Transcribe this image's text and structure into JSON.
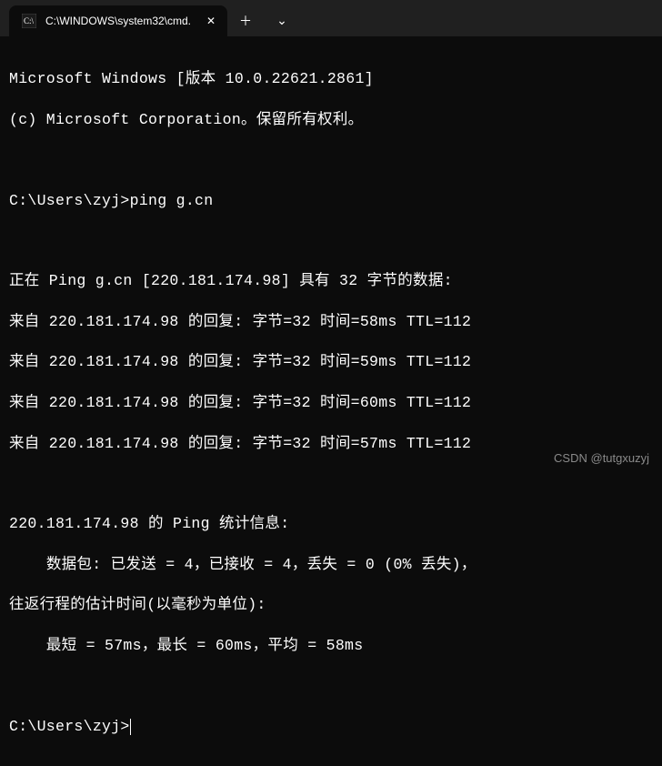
{
  "titlebar": {
    "tab_title": "C:\\WINDOWS\\system32\\cmd.",
    "close_glyph": "✕",
    "new_tab_glyph": "＋",
    "dropdown_glyph": "⌄"
  },
  "terminal": {
    "line_version": "Microsoft Windows [版本 10.0.22621.2861]",
    "line_copyright": "(c) Microsoft Corporation。保留所有权利。",
    "line_prompt1": "C:\\Users\\zyj>ping g.cn",
    "line_ping_header": "正在 Ping g.cn [220.181.174.98] 具有 32 字节的数据:",
    "line_reply1": "来自 220.181.174.98 的回复: 字节=32 时间=58ms TTL=112",
    "line_reply2": "来自 220.181.174.98 的回复: 字节=32 时间=59ms TTL=112",
    "line_reply3": "来自 220.181.174.98 的回复: 字节=32 时间=60ms TTL=112",
    "line_reply4": "来自 220.181.174.98 的回复: 字节=32 时间=57ms TTL=112",
    "line_stats_header": "220.181.174.98 的 Ping 统计信息:",
    "line_packets": "    数据包: 已发送 = 4，已接收 = 4，丢失 = 0 (0% 丢失)，",
    "line_rtt_header": "往返行程的估计时间(以毫秒为单位):",
    "line_rtt_values": "    最短 = 57ms，最长 = 60ms，平均 = 58ms",
    "line_prompt2": "C:\\Users\\zyj>"
  },
  "watermark": "CSDN @tutgxuzyj"
}
